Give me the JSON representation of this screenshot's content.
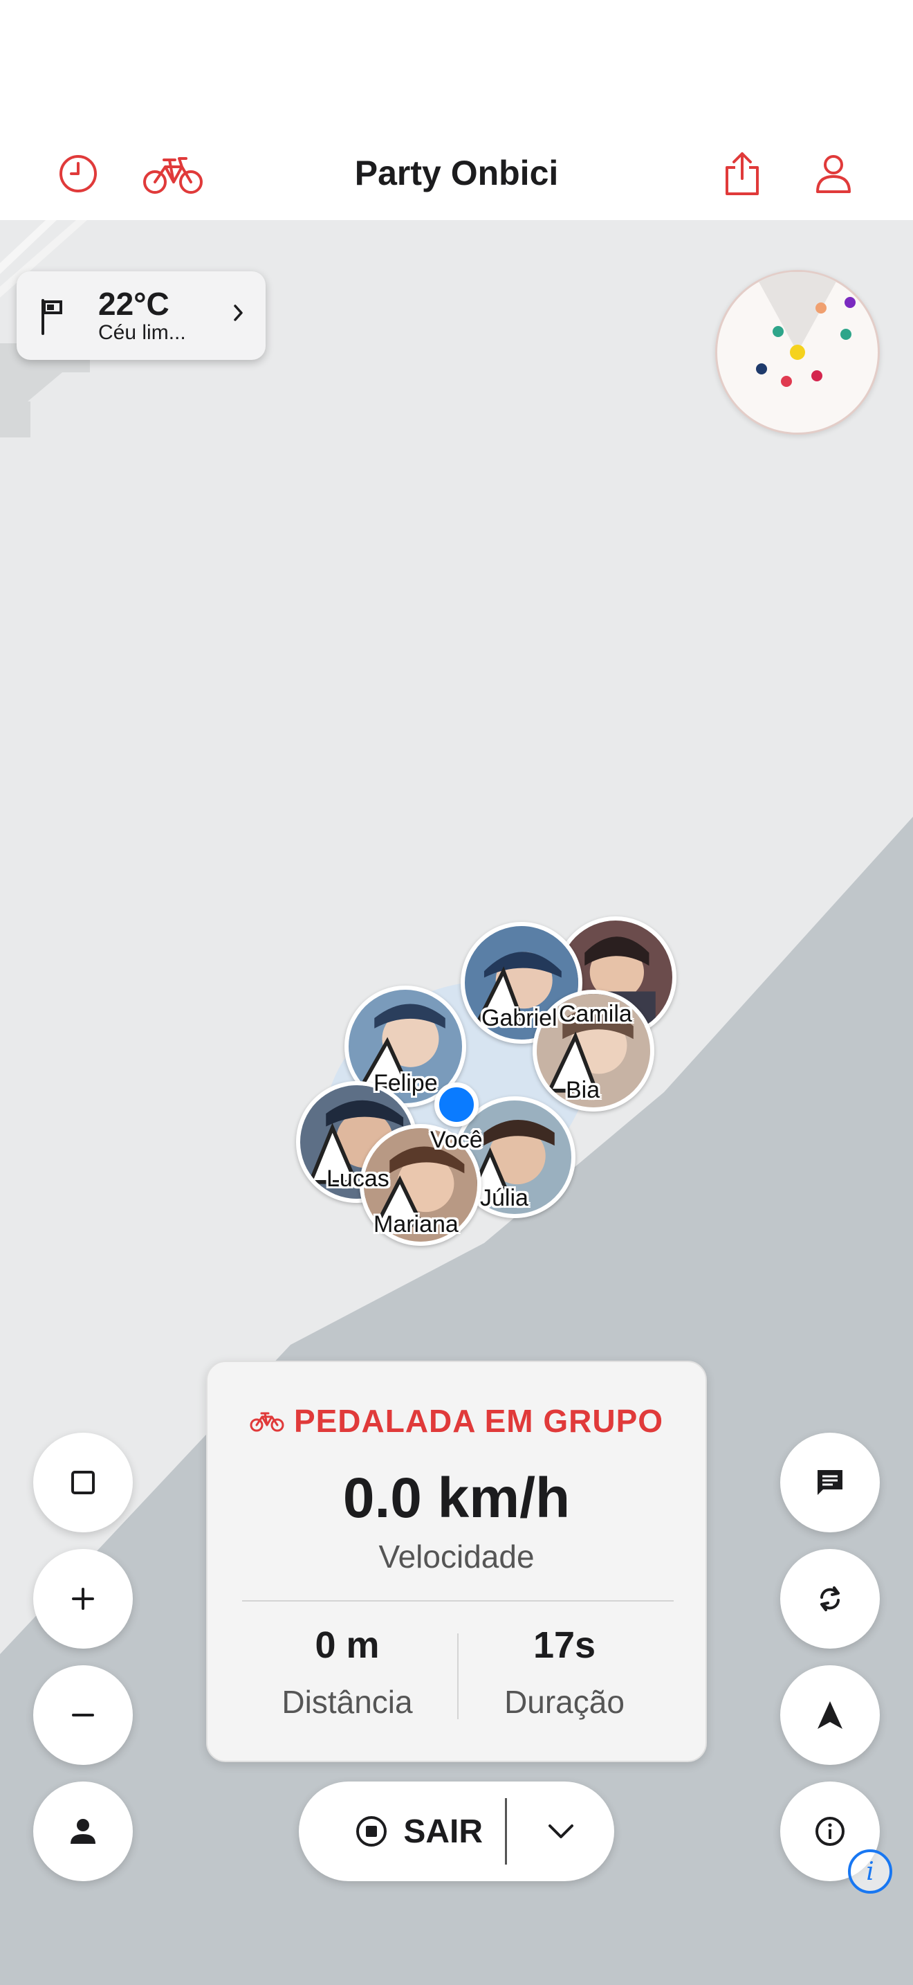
{
  "header": {
    "title": "Party Onbici",
    "icons": {
      "history": "clock-icon",
      "bike": "bike-icon",
      "share": "share-icon",
      "profile": "person-icon"
    },
    "accent_color": "#e03a3a"
  },
  "weather": {
    "temperature": "22°C",
    "condition": "Céu lim..."
  },
  "riders": [
    {
      "name": "Gabriel"
    },
    {
      "name": "Camila"
    },
    {
      "name": "Felipe"
    },
    {
      "name": "Bia"
    },
    {
      "name": "Você"
    },
    {
      "name": "Lucas"
    },
    {
      "name": "Júlia"
    },
    {
      "name": "Mariana"
    }
  ],
  "stats": {
    "mode": "PEDALADA EM GRUPO",
    "speed": "0.0 km/h",
    "speed_label": "Velocidade",
    "distance": "0 m",
    "distance_label": "Distância",
    "duration": "17s",
    "duration_label": "Duração"
  },
  "exit": {
    "label": "SAIR"
  },
  "colors": {
    "user_dot": "#0a7bff",
    "map_land": "#e9eaeb",
    "map_water": "#c0c6ca"
  }
}
